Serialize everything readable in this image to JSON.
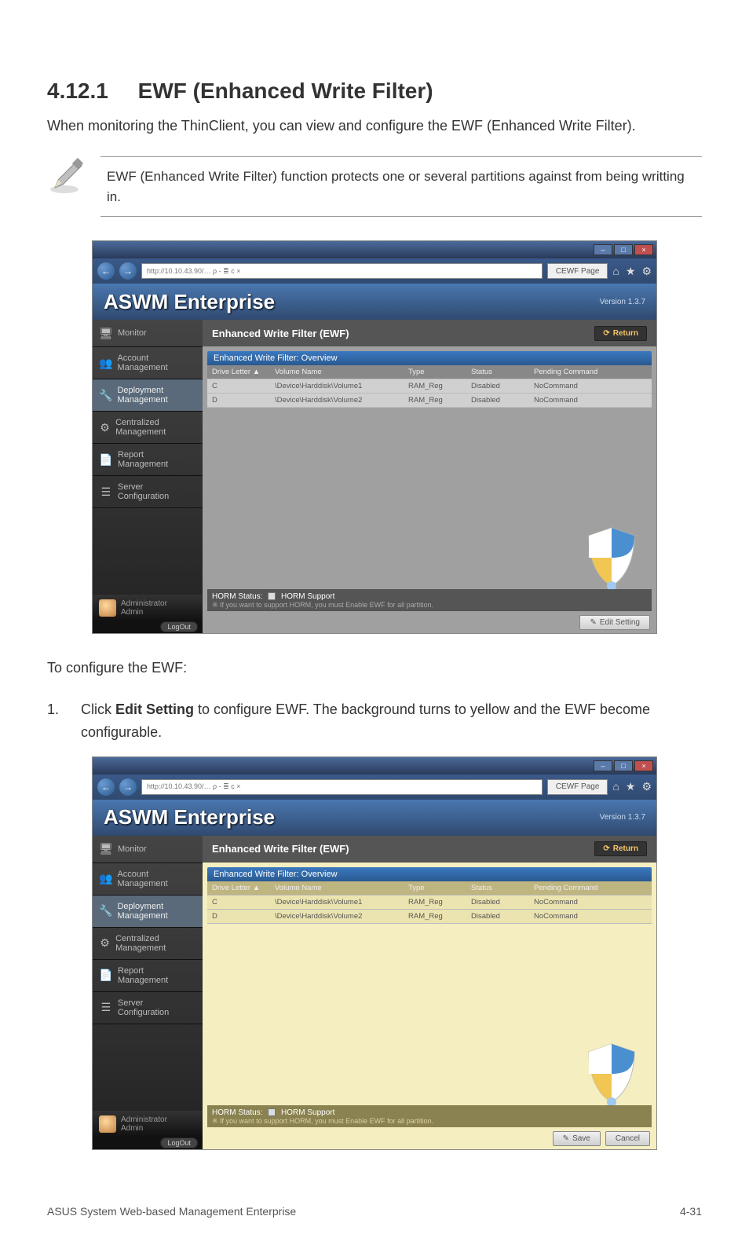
{
  "section": {
    "number": "4.12.1",
    "title": "EWF (Enhanced Write Filter)"
  },
  "intro": "When monitoring the ThinClient, you can view and configure the EWF (Enhanced Write Filter).",
  "note": "EWF (Enhanced Write Filter) function protects one or several partitions against from being writting in.",
  "configure_line": "To configure the EWF:",
  "step1": {
    "num": "1.",
    "text_before": "Click ",
    "bold": "Edit Setting",
    "text_after": " to configure EWF. The background turns to yellow and the EWF become configurable."
  },
  "footer": {
    "left": "ASUS System Web-based Management Enterprise",
    "right": "4-31"
  },
  "app": {
    "url": "http://10.10.43.90/…  ρ - ≣ c ×",
    "tab": "CEWF Page",
    "brand": "ASWM Enterprise",
    "version": "Version 1.3.7",
    "panel_heading": "Enhanced Write Filter (EWF)",
    "return_label": "Return",
    "panel_title": "Enhanced Write Filter: Overview",
    "nav": {
      "monitor": "Monitor",
      "account": "Account Management",
      "deploy": "Deployment Management",
      "central": "Centralized Management",
      "report": "Report Management",
      "server": "Server Configuration"
    },
    "table": {
      "headers": {
        "drive": "Drive Letter ▲",
        "vol": "Volume Name",
        "type": "Type",
        "status": "Status",
        "pending": "Pending Command"
      },
      "rows": [
        {
          "drive": "C",
          "vol": "\\Device\\Harddisk\\Volume1",
          "type": "RAM_Reg",
          "status": "Disabled",
          "pending": "NoCommand"
        },
        {
          "drive": "D",
          "vol": "\\Device\\Harddisk\\Volume2",
          "type": "RAM_Reg",
          "status": "Disabled",
          "pending": "NoCommand"
        }
      ]
    },
    "horm": {
      "label": "HORM Status:",
      "value": "HORM Support",
      "hint": "※ If you want to support HORM, you must Enable EWF for all partition."
    },
    "user": {
      "role": "Administrator",
      "name": "Admin",
      "logout": "LogOut"
    },
    "buttons": {
      "edit": "Edit Setting",
      "save": "Save",
      "cancel": "Cancel"
    }
  }
}
